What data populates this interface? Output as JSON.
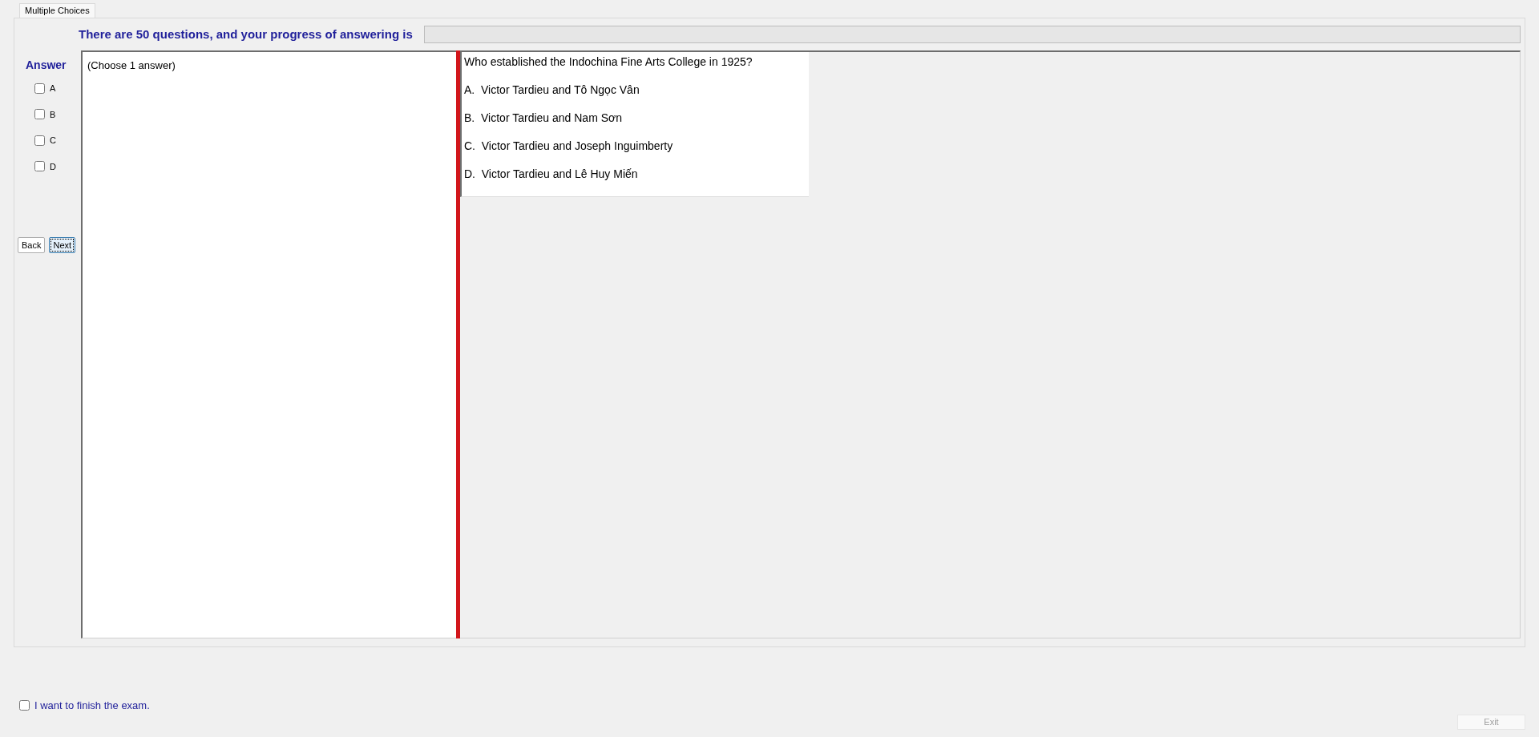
{
  "tabs": [
    {
      "label": "Multiple Choices",
      "selected": true
    }
  ],
  "progress": {
    "text": "There are 50 questions, and your progress of answering is",
    "level": 0
  },
  "answer_panel": {
    "title": "Answer",
    "options": [
      {
        "label": "A",
        "checked": false
      },
      {
        "label": "B",
        "checked": false
      },
      {
        "label": "C",
        "checked": false
      },
      {
        "label": "D",
        "checked": false
      }
    ]
  },
  "nav_buttons": [
    {
      "label": "Back",
      "focused": false
    },
    {
      "label": "Next",
      "focused": true
    }
  ],
  "instruction": "(Choose 1 answer)",
  "question": {
    "text": "Who established the Indochina Fine Arts College in 1925?",
    "choices": [
      "A.  Victor Tardieu and Tô Ngọc Vân",
      "B.  Victor Tardieu and Nam Sơn",
      "C.  Victor Tardieu and Joseph Inguimberty",
      "D.  Victor Tardieu and Lê Huy Miến"
    ]
  },
  "finish": {
    "label": "I want to finish the exam.",
    "checked": false
  },
  "exit_button": {
    "label": "Exit",
    "disabled": true
  }
}
